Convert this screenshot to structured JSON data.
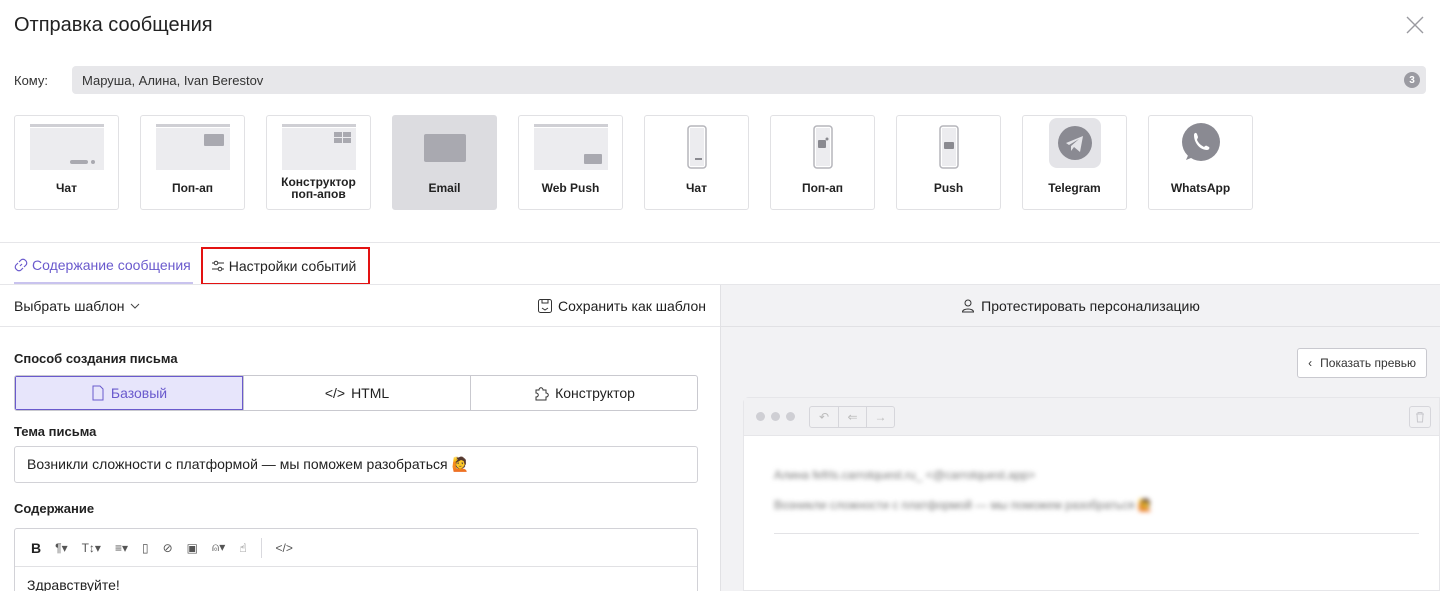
{
  "title": "Отправка сообщения",
  "to": {
    "label": "Кому:",
    "value": "Маруша, Алина, Ivan Berestov",
    "count": "3"
  },
  "channels": [
    {
      "label": "Чат",
      "icon": "web-chat-thumb"
    },
    {
      "label": "Поп-ап",
      "icon": "web-popup-thumb"
    },
    {
      "label": "Конструктор поп-апов",
      "icon": "popup-builder-thumb"
    },
    {
      "label": "Email",
      "icon": "email-thumb",
      "active": true
    },
    {
      "label": "Web Push",
      "icon": "web-push-thumb"
    },
    {
      "label": "Чат",
      "icon": "mobile-chat-thumb"
    },
    {
      "label": "Поп-ап",
      "icon": "mobile-popup-thumb"
    },
    {
      "label": "Push",
      "icon": "mobile-push-thumb"
    },
    {
      "label": "Telegram",
      "icon": "telegram-icon"
    },
    {
      "label": "WhatsApp",
      "icon": "whatsapp-icon"
    }
  ],
  "tabs": {
    "content": "Содержание сообщения",
    "events": "Настройки событий"
  },
  "left": {
    "choose_template": "Выбрать шаблон",
    "save_template": "Сохранить как шаблон",
    "method_label": "Способ создания письма",
    "methods": [
      "Базовый",
      "HTML",
      "Конструктор"
    ],
    "subject_label": "Тема письма",
    "subject_value": "Возникли сложности с платформой — мы поможем разобраться 🙋",
    "content_label": "Содержание",
    "body_text": "Здравствуйте!"
  },
  "right": {
    "test_personalization": "Протестировать персонализацию",
    "show_preview": "Показать превью",
    "preview_from": "Алина fefrls.carrotquest.ru_ <@carrotquest.app>",
    "preview_subject": "Возникли сложности с платформой — мы поможем разобраться 🙋"
  },
  "colors": {
    "accent": "#6a5acd",
    "highlight": "#e31212",
    "active_channel": "#dcdce0"
  }
}
